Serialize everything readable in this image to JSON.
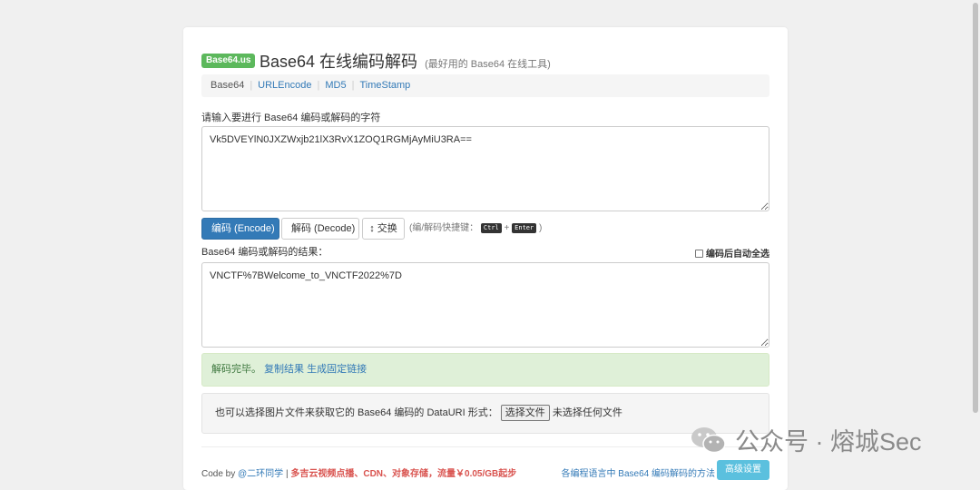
{
  "header": {
    "brand": "Base64.us",
    "title": "Base64 在线编码解码",
    "subtitle": "(最好用的 Base64 在线工具)"
  },
  "nav": {
    "items": [
      "Base64",
      "URLEncode",
      "MD5",
      "TimeStamp"
    ]
  },
  "input": {
    "label": "请输入要进行 Base64 编码或解码的字符",
    "value": "Vk5DVEYlN0JXZWxjb21lX3RvX1ZOQ1RGMjAyMiU3RA=="
  },
  "actions": {
    "encode": "编码 (Encode)",
    "decode": "解码 (Decode)",
    "swap_glyph": "↕",
    "swap": "交换",
    "hint_prefix": "(编/解码快捷键：",
    "key_ctrl": "Ctrl",
    "plus": "+",
    "key_enter": "Enter",
    "hint_suffix": ")"
  },
  "output": {
    "label": "Base64 编码或解码的结果：",
    "auto_select": "编码后自动全选",
    "value": "VNCTF%7BWelcome_to_VNCTF2022%7D"
  },
  "status": {
    "message": "解码完毕。",
    "copy": "复制结果",
    "permalink": "生成固定链接"
  },
  "upload": {
    "text": "也可以选择图片文件来获取它的 Base64 编码的 DataURI 形式：",
    "button": "选择文件",
    "no_file": "未选择任何文件"
  },
  "footer": {
    "code_by": "Code by",
    "author": "@二环同学",
    "separator": "|",
    "ad": "多吉云视频点播、CDN、对象存储，流量￥0.05/GB起步",
    "methods": "各编程语言中 Base64 编码解码的方法",
    "advanced": "高级设置"
  },
  "watermark": {
    "text": "公众号 · 熔城Sec"
  }
}
